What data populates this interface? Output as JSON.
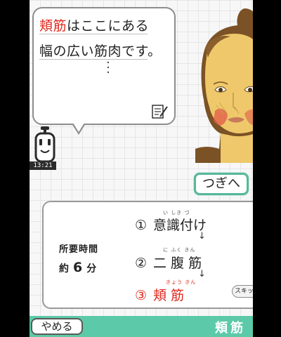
{
  "bubble": {
    "highlight": "頬筋",
    "line1_rest": "はここにある",
    "line2": "幅の広い筋肉です。"
  },
  "clock": "13:21",
  "next_button": "つぎへ",
  "duration": {
    "label": "所要時間",
    "prefix": "約",
    "number": "6",
    "unit": "分"
  },
  "steps": [
    {
      "num": "①",
      "text": "意識付け",
      "ruby": "い しき づ"
    },
    {
      "num": "②",
      "text": "二 腹 筋",
      "ruby": "に  ふく  きん"
    },
    {
      "num": "③",
      "text": "頬  筋",
      "ruby": "きょう   きん"
    }
  ],
  "skip_button": "スキップ",
  "quit_button": "やめる",
  "current_title": "頬筋",
  "colors": {
    "accent_green": "#5ccaa8",
    "highlight_red": "#e0281e"
  },
  "icons": [
    "memo-icon",
    "robot-icon",
    "down-arrow-icon",
    "face-illustration"
  ]
}
